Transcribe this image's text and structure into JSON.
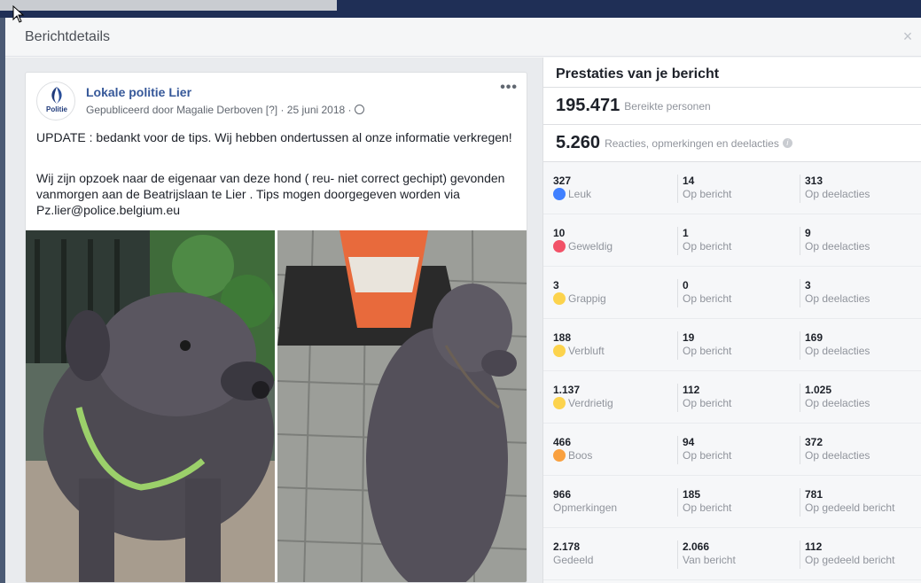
{
  "modal": {
    "title": "Berichtdetails",
    "close_label": "×"
  },
  "post": {
    "page_name": "Lokale politie Lier",
    "avatar_text": "Politie",
    "meta": "Gepubliceerd door Magalie Derboven [?] · 25 juni 2018 ·",
    "more_label": "•••",
    "text1": "UPDATE : bedankt voor de tips. Wij hebben ondertussen al onze informatie verkregen!",
    "text2": "Wij zijn opzoek naar de eigenaar van deze hond ( reu- niet correct gechipt) gevonden vanmorgen aan de Beatrijslaan te Lier . Tips mogen doorgegeven worden via Pz.lier@police.belgium.eu"
  },
  "stats": {
    "title": "Prestaties van je bericht",
    "reach_value": "195.471",
    "reach_label": "Bereikte personen",
    "engagement_value": "5.260",
    "engagement_label": "Reacties, opmerkingen en deelacties",
    "rows": [
      {
        "icon": "like-icon",
        "total": "327",
        "label": "Leuk",
        "post": "14",
        "post_label": "Op bericht",
        "shares": "313",
        "shares_label": "Op deelacties"
      },
      {
        "icon": "love-icon",
        "total": "10",
        "label": "Geweldig",
        "post": "1",
        "post_label": "Op bericht",
        "shares": "9",
        "shares_label": "Op deelacties"
      },
      {
        "icon": "haha-icon",
        "total": "3",
        "label": "Grappig",
        "post": "0",
        "post_label": "Op bericht",
        "shares": "3",
        "shares_label": "Op deelacties"
      },
      {
        "icon": "wow-icon",
        "total": "188",
        "label": "Verbluft",
        "post": "19",
        "post_label": "Op bericht",
        "shares": "169",
        "shares_label": "Op deelacties"
      },
      {
        "icon": "sad-icon",
        "total": "1.137",
        "label": "Verdrietig",
        "post": "112",
        "post_label": "Op bericht",
        "shares": "1.025",
        "shares_label": "Op deelacties"
      },
      {
        "icon": "angry-icon",
        "total": "466",
        "label": "Boos",
        "post": "94",
        "post_label": "Op bericht",
        "shares": "372",
        "shares_label": "Op deelacties"
      },
      {
        "icon": "",
        "total": "966",
        "label": "Opmerkingen",
        "post": "185",
        "post_label": "Op bericht",
        "shares": "781",
        "shares_label": "Op gedeeld bericht"
      },
      {
        "icon": "",
        "total": "2.178",
        "label": "Gedeeld",
        "post": "2.066",
        "post_label": "Van bericht",
        "shares": "112",
        "shares_label": "Op gedeeld bericht"
      }
    ]
  },
  "colors": {
    "link": "#365899",
    "like": "#4080ff",
    "love": "#f25268",
    "header": "#1f2f56"
  }
}
